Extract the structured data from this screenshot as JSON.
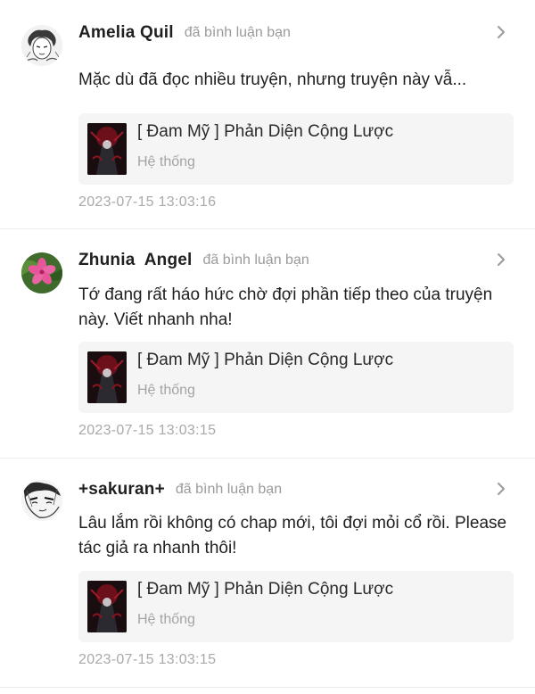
{
  "comments": [
    {
      "avatar_icon": "manga-avatar-icon",
      "name": "Amelia Quil",
      "action": "đã bình luận bạn",
      "text": "Mặc dù đã đọc nhiều truyện, nhưng truyện này vẫ...",
      "story_title": "[ Đam Mỹ ] Phản Diện Cộng Lược",
      "story_sub": "Hệ thống",
      "timestamp": "2023-07-15 13:03:16"
    },
    {
      "avatar_icon": "pink-flower-avatar-icon",
      "name": "Zhunia  Angel",
      "action": "đã bình luận bạn",
      "text": "Tớ đang rất háo hức chờ đợi phần tiếp theo của truyện này. Viết nhanh nha!",
      "story_title": "[ Đam Mỹ ] Phản Diện Cộng Lược",
      "story_sub": "Hệ thống",
      "timestamp": "2023-07-15 13:03:15"
    },
    {
      "avatar_icon": "sketch-face-avatar-icon",
      "name": "+sakuran+",
      "action": "đã bình luận bạn",
      "text": "Lâu lắm rồi không có chap mới, tôi đợi mỏi cổ rồi. Please tác giả ra nhanh thôi!",
      "story_title": "[ Đam Mỹ ] Phản Diện Cộng Lược",
      "story_sub": "Hệ thống",
      "timestamp": "2023-07-15 13:03:15"
    }
  ],
  "icons": {
    "chevron": "chevron-right-icon",
    "cover": "book-cover-icon"
  },
  "colors": {
    "name": "#1f1f1f",
    "secondary": "#9a9a9a",
    "card_bg": "#f5f5f5",
    "flower": "#e8569a",
    "leaf": "#3f7a2e"
  }
}
